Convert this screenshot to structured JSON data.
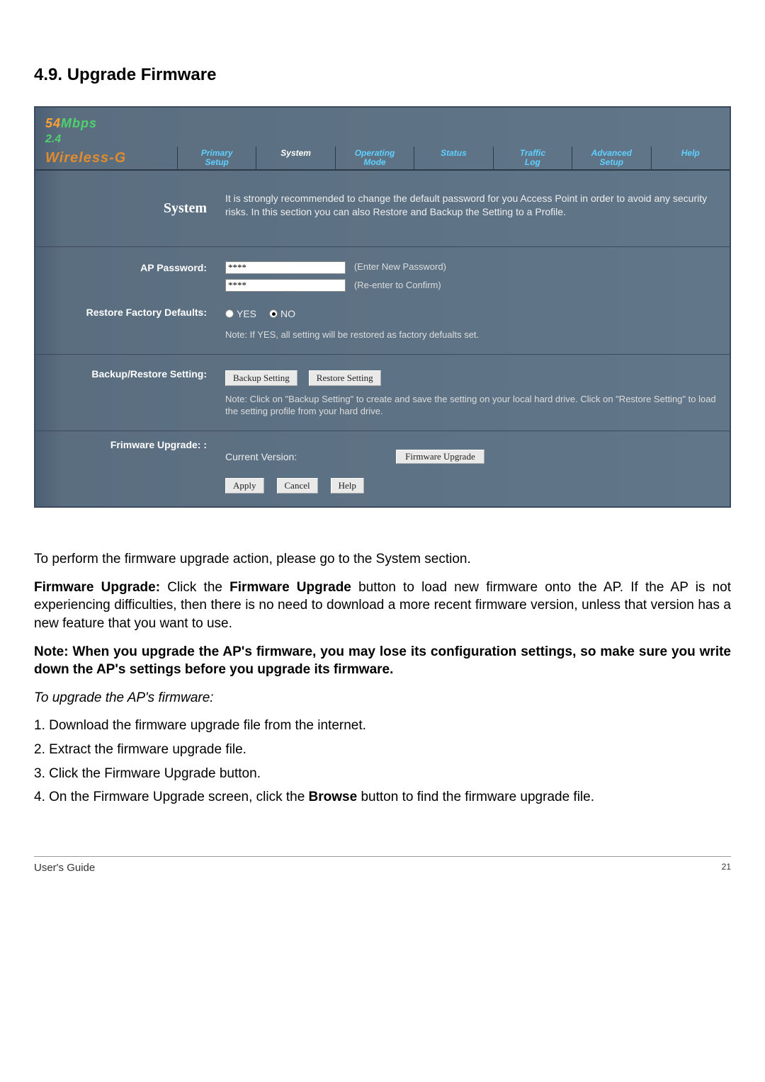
{
  "section_title": "4.9. Upgrade Firmware",
  "logo": {
    "n54": "54",
    "mbps": "Mbps",
    "ghz": "2.4"
  },
  "brand": "Wireless-G",
  "tabs": [
    {
      "l1": "Primary",
      "l2": "Setup"
    },
    {
      "l1": "System",
      "l2": ""
    },
    {
      "l1": "Operating",
      "l2": "Mode"
    },
    {
      "l1": "Status",
      "l2": ""
    },
    {
      "l1": "Traffic",
      "l2": "Log"
    },
    {
      "l1": "Advanced",
      "l2": "Setup"
    },
    {
      "l1": "Help",
      "l2": ""
    }
  ],
  "system": {
    "title": "System",
    "desc": "It is strongly recommended to change the default password for you Access Point in order to avoid any security risks. In this section you can also Restore and Backup the Setting to a Profile."
  },
  "pw": {
    "label": "AP Password:",
    "value1": "****",
    "hint1": "(Enter New Password)",
    "value2": "****",
    "hint2": "(Re-enter to Confirm)"
  },
  "restore": {
    "label": "Restore Factory Defaults:",
    "yes": "YES",
    "no": "NO",
    "note": "Note: If YES, all setting will be restored as factory defualts set."
  },
  "backup": {
    "label": "Backup/Restore Setting:",
    "btn_backup": "Backup Setting",
    "btn_restore": "Restore Setting",
    "note": "Note: Click on \"Backup Setting\" to create and save the setting on your local hard drive. Click on \"Restore Setting\" to load the setting profile from your hard drive."
  },
  "fw": {
    "label": "Frimware Upgrade: :",
    "curver": "Current Version:",
    "btn": "Firmware Upgrade"
  },
  "actions": {
    "apply": "Apply",
    "cancel": "Cancel",
    "help": "Help"
  },
  "body": {
    "p1": "To perform the firmware upgrade action, please go to the System section.",
    "p2a": "Firmware Upgrade:",
    "p2b": " Click the ",
    "p2c": "Firmware Upgrade",
    "p2d": " button to load new firmware onto the AP. If the AP is not experiencing difficulties, then there is no need to download a more recent firmware version, unless that version has a new feature that you want to use.",
    "p3": "Note: When you upgrade the AP's firmware, you may lose its configuration settings, so make sure you write down the AP's settings before you upgrade its firmware.",
    "p4": "To upgrade the AP's firmware:",
    "li1": "1. Download the firmware upgrade file from the internet.",
    "li2": "2. Extract the firmware upgrade file.",
    "li3": "3. Click the Firmware Upgrade button.",
    "li4a": "4. On the Firmware Upgrade screen, click the ",
    "li4b": "Browse",
    "li4c": " button to find the firmware upgrade file."
  },
  "footer": {
    "left": "User's Guide",
    "page": "21"
  }
}
